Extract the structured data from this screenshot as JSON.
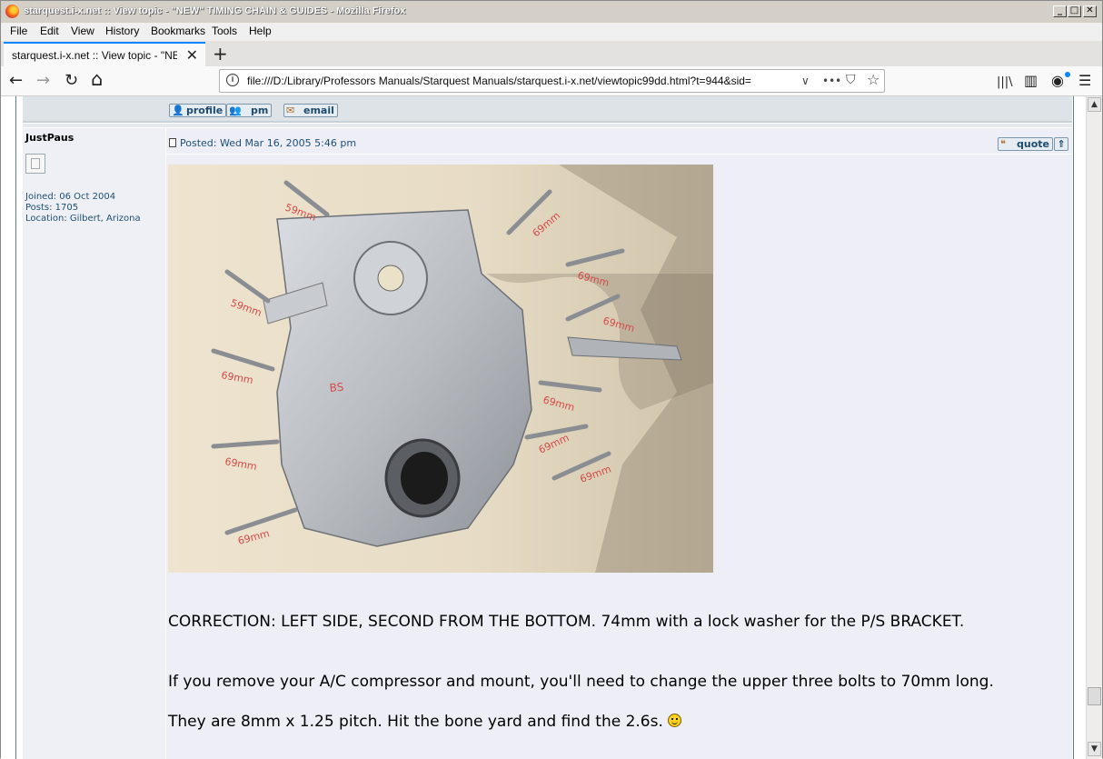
{
  "window": {
    "title": "starquest.i-x.net :: View topic - \"NEW\" TIMING CHAIN & GUIDES - Mozilla Firefox",
    "controls": {
      "minimize": "_",
      "maximize": "□",
      "close": "✕"
    }
  },
  "menubar": {
    "items": [
      "File",
      "Edit",
      "View",
      "History",
      "Bookmarks",
      "Tools",
      "Help"
    ]
  },
  "tabs": {
    "active_label": "starquest.i-x.net :: View topic - \"NEW\" TIMING CHAIN & GUIDES",
    "close": "✕",
    "new_tab": "+"
  },
  "navbar": {
    "url": "file:///D:/Library/Professors Manuals/Starquest Manuals/starquest.i-x.net/viewtopic99dd.html?t=944&sid=",
    "back": "←",
    "forward": "→",
    "reload": "↻",
    "home": "⌂",
    "url_dropdown": "∨",
    "more": "•••",
    "pocket": "⛉",
    "bookmark_star": "☆",
    "library": "|||\\",
    "sidebar": "▥",
    "account": "◉",
    "menu": "☰"
  },
  "prev_post_buttons": [
    "profile",
    "pm",
    "email"
  ],
  "post": {
    "author": "JustPaus",
    "joined": "Joined: 06 Oct 2004",
    "posts": "Posts: 1705",
    "location": "Location: Gilbert, Arizona",
    "posted": "Posted: Wed Mar 16, 2005 5:46 pm",
    "quote_label": "quote",
    "top_label": "⇑",
    "photo_labels": [
      "59mm",
      "69mm",
      "69mm",
      "69mm",
      "59mm",
      "69mm",
      "69mm",
      "69mm",
      "69mm",
      "69mm",
      "69mm",
      "69mm",
      "BS"
    ],
    "text": [
      "CORRECTION: LEFT SIDE, SECOND FROM THE BOTTOM. 74mm with a lock washer for the P/S BRACKET.",
      "If you remove your A/C compressor and mount, you'll need to change the upper three bolts to 70mm long.",
      "They are 8mm x 1.25 pitch. Hit the bone yard and find the 2.6s."
    ]
  },
  "scrollbar": {
    "up": "▲",
    "down": "▼"
  }
}
